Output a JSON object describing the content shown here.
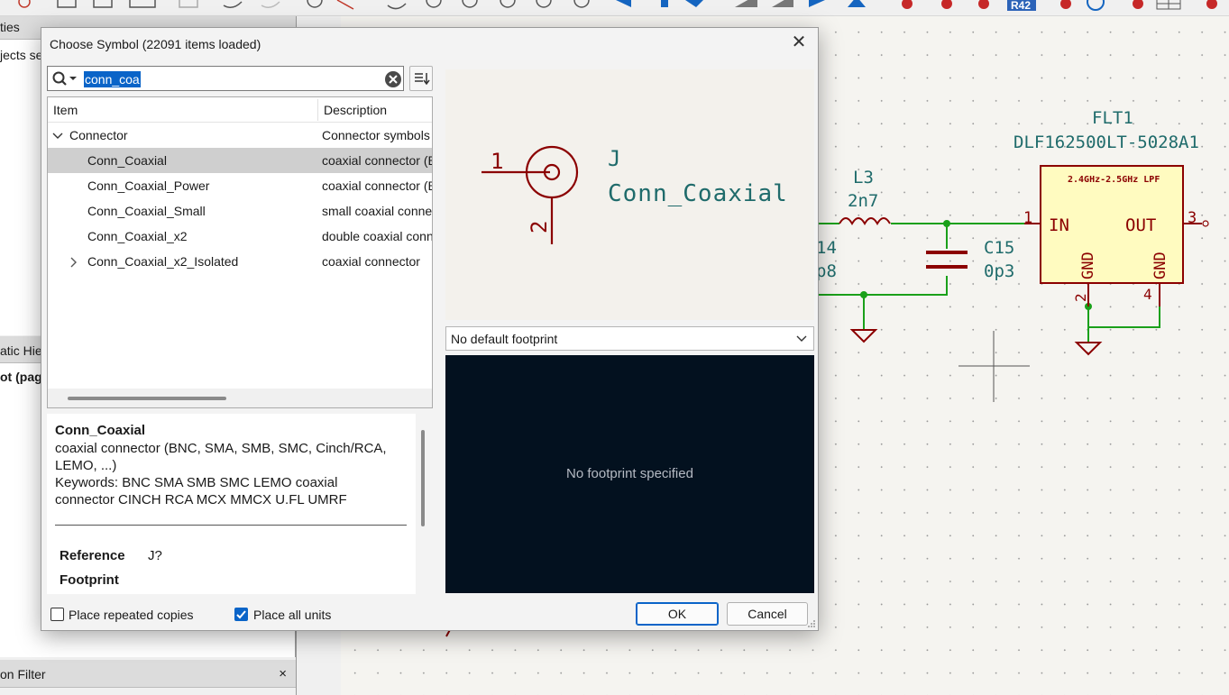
{
  "background": {
    "panel_properties_title": "ties",
    "panel_properties_row": "jects se",
    "panel_hierarchy_title": "atic Hie",
    "panel_hierarchy_row": "ot (pag",
    "panel_filter_title": "on Filter",
    "panel_close_glyph": "×",
    "toolbar_badge": "R42",
    "schematic": {
      "flt_ref": "FLT1",
      "flt_value": "DLF162500LT-5028A1",
      "flt_body_text": "2.4GHz-2.5GHz  LPF",
      "flt_pin_in": "IN",
      "flt_pin_out": "OUT",
      "flt_gnd_left": "GND",
      "flt_gnd_right": "GND",
      "flt_pin1": "1",
      "flt_pin2": "2",
      "flt_pin3": "3",
      "flt_pin4": "4",
      "l3_ref": "L3",
      "l3_value": "2n7",
      "c15_ref": "C15",
      "c15_value": "0p3",
      "left_ref_partial": "14",
      "left_val_partial": "p8",
      "wire_color": "#1aa01a",
      "symbol_color": "#8b0000",
      "body_fill": "#fffbc0"
    }
  },
  "dialog": {
    "title": "Choose Symbol (22091 items loaded)",
    "close_glyph": "✕",
    "search_value": "conn_coa",
    "columns": {
      "item": "Item",
      "description": "Description"
    },
    "rows": [
      {
        "item": "Connector",
        "description": "Connector symbols",
        "expander": "⌄",
        "level": 0
      },
      {
        "item": "Conn_Coaxial",
        "description": "coaxial connector (BNC, SMA",
        "expander": "",
        "level": 1,
        "selected": true
      },
      {
        "item": "Conn_Coaxial_Power",
        "description": "coaxial connector (BNC",
        "expander": "",
        "level": 1
      },
      {
        "item": "Conn_Coaxial_Small",
        "description": "small coaxial connector",
        "expander": "",
        "level": 1
      },
      {
        "item": "Conn_Coaxial_x2",
        "description": "double coaxial connector",
        "expander": "",
        "level": 1
      },
      {
        "item": "Conn_Coaxial_x2_Isolated",
        "description": "coaxial connector",
        "expander": "›",
        "level": 1
      }
    ],
    "info": {
      "name": "Conn_Coaxial",
      "description": "coaxial connector (BNC, SMA, SMB, SMC, Cinch/RCA, LEMO, ...)",
      "keywords": "Keywords: BNC SMA SMB SMC LEMO coaxial connector CINCH RCA MCX MMCX U.FL UMRF",
      "reference_label": "Reference",
      "reference_value": "J?",
      "footprint_label": "Footprint"
    },
    "preview": {
      "ref": "J",
      "value": "Conn_Coaxial",
      "pin1": "1",
      "pin2": "2",
      "color": "#8b0000",
      "text_color": "#1f6b6b"
    },
    "footprint_select": "No default footprint",
    "footprint_message": "No footprint specified",
    "place_repeated_label": "Place repeated copies",
    "place_repeated_checked": false,
    "place_all_units_label": "Place all units",
    "place_all_units_checked": true,
    "ok_label": "OK",
    "cancel_label": "Cancel"
  }
}
